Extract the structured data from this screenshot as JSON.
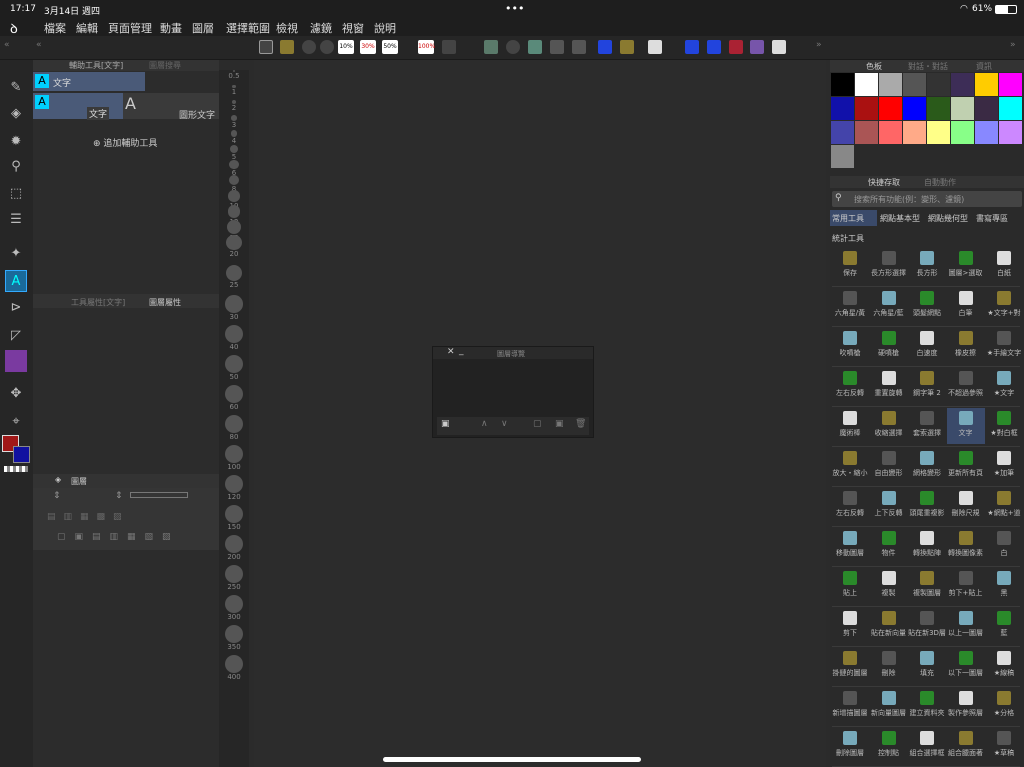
{
  "status": {
    "time": "17:17",
    "date": "3月14日 週四",
    "battery": "61%",
    "dots": "•••"
  },
  "menu": [
    "檔案",
    "編輯",
    "頁面管理",
    "動畫",
    "圖層",
    "選擇範圍",
    "檢視",
    "濾鏡",
    "視窗",
    "說明"
  ],
  "toolstrip": {
    "zoom_labels": [
      "10%",
      "30%",
      "50%",
      "100%"
    ]
  },
  "subtool_panel": {
    "tab1": "輔助工具[文字]",
    "tab2": "圖層搜尋",
    "group": "文字",
    "item1": "文字",
    "item2": "圖形文字",
    "add": "追加輔助工具"
  },
  "tool_property": {
    "tab1": "工具屬性[文字]",
    "tab2": "圖層屬性"
  },
  "layer_panel": {
    "title": "圖層"
  },
  "brush_sizes": [
    "0.5",
    "1",
    "2",
    "3",
    "4",
    "5",
    "6",
    "8",
    "10",
    "12",
    "15",
    "20",
    "25",
    "30",
    "40",
    "50",
    "60",
    "80",
    "100",
    "120",
    "150",
    "200",
    "250",
    "300",
    "350",
    "400"
  ],
  "navigator": {
    "title": "圖層導覽"
  },
  "color_panel": {
    "tab1": "色板",
    "tab2": "對話・對話",
    "tab3": "資訊"
  },
  "swatches": [
    "#000000",
    "#ffffff",
    "#aaaaaa",
    "#555555",
    "#333333",
    "#3d2d57",
    "#ffcc00",
    "#ff00ff",
    "#1111aa",
    "#aa1111",
    "#ff0000",
    "#0000ff",
    "#2a5a1a",
    "#c0d0b0",
    "#3a2a44",
    "#00ffff",
    "#4444aa",
    "#aa5555",
    "#ff6666",
    "#ffaa88",
    "#ffff88",
    "#88ff88",
    "#8888ff",
    "#cc88ff",
    "#888888"
  ],
  "quick_access": {
    "tab1": "快捷存取",
    "tab2": "自動動作",
    "search_placeholder": "搜索所有功能(例：變形、濾鏡)",
    "tabs": [
      "常用工具",
      "網點基本型",
      "網點幾何型",
      "書寫專區",
      "統計工具"
    ]
  },
  "commands": [
    [
      "保存",
      "長方形選擇",
      "長方形",
      "圖層>選取",
      "白紙"
    ],
    [
      "六角星/黃",
      "六角星/藍",
      "頭髮網點",
      "白筆",
      "★文字+對"
    ],
    [
      "吹噴槍",
      "硬噴槍",
      "白速度",
      "橡皮擦",
      "★手繪文字"
    ],
    [
      "左右反轉",
      "重置旋轉",
      "鋼字筆 2",
      "不超過參照",
      "★文字"
    ],
    [
      "魔術棒",
      "收縮選擇",
      "套索選擇",
      "文字",
      "★對白框"
    ],
    [
      "放大・縮小",
      "自由變形",
      "網格變形",
      "更新所有頁",
      "★加筆"
    ],
    [
      "左右反轉",
      "上下反轉",
      "頭尾重複影",
      "刪除尺規",
      "★網點+道"
    ],
    [
      "移動圖層",
      "物件",
      "轉換點陣",
      "轉換圖像素",
      "白"
    ],
    [
      "貼上",
      "複製",
      "複製圖層",
      "剪下+貼上",
      "黑"
    ],
    [
      "剪下",
      "貼在新向量",
      "貼在新3D層",
      "以上一圖層",
      "藍"
    ],
    [
      "掛鏈的圖層",
      "刪除",
      "填充",
      "以下一圖層",
      "★線稿"
    ],
    [
      "新增描圖層",
      "新向量圖層",
      "建立資料夾",
      "製作參照層",
      "★分格"
    ],
    [
      "刪除圖層",
      "控制點",
      "組合選擇框",
      "組合臘面著",
      "★草稿"
    ]
  ]
}
